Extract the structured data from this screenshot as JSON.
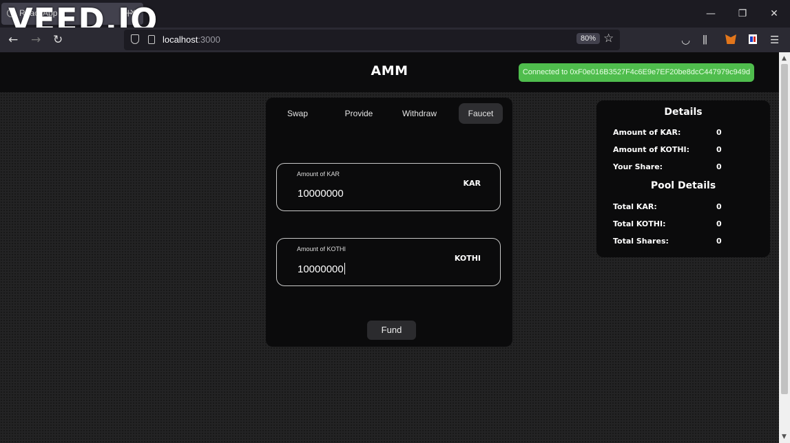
{
  "browser": {
    "tab_title": "React App",
    "tab_close": "✕",
    "new_tab": "+",
    "watermark": "VEED.IO",
    "window_controls": {
      "minimize": "—",
      "restore": "❐",
      "close": "✕"
    },
    "nav": {
      "back": "←",
      "forward": "→",
      "reload": "↻"
    },
    "url_host": "localhost",
    "url_port": ":3000",
    "zoom": "80%",
    "bookmark_star": "☆",
    "toolbar_icons": {
      "pocket": "◡",
      "library": "⫼",
      "menu": "☰"
    }
  },
  "app": {
    "title": "AMM",
    "connected": "Connected to 0xF0e016B3527F4c6E9e7EF20be8dcC447979c949d",
    "tabs": [
      {
        "label": "Swap",
        "active": false
      },
      {
        "label": "Provide",
        "active": false
      },
      {
        "label": "Withdraw",
        "active": false
      },
      {
        "label": "Faucet",
        "active": true
      }
    ],
    "fields": [
      {
        "label": "Amount of KAR",
        "value": "10000000",
        "token": "KAR"
      },
      {
        "label": "Amount of KOTHI",
        "value": "10000000",
        "token": "KOTHI"
      }
    ],
    "fund_label": "Fund"
  },
  "details": {
    "heading": "Details",
    "rows": [
      {
        "label": "Amount of KAR:",
        "value": "0"
      },
      {
        "label": "Amount of KOTHI:",
        "value": "0"
      },
      {
        "label": "Your Share:",
        "value": "0"
      }
    ],
    "pool_heading": "Pool Details",
    "pool_rows": [
      {
        "label": "Total KAR:",
        "value": "0"
      },
      {
        "label": "Total KOTHI:",
        "value": "0"
      },
      {
        "label": "Total Shares:",
        "value": "0"
      }
    ]
  },
  "colors": {
    "connected_bg": "#4fbd4d",
    "card_bg": "#0b0b0c",
    "page_bg": "#232324"
  }
}
